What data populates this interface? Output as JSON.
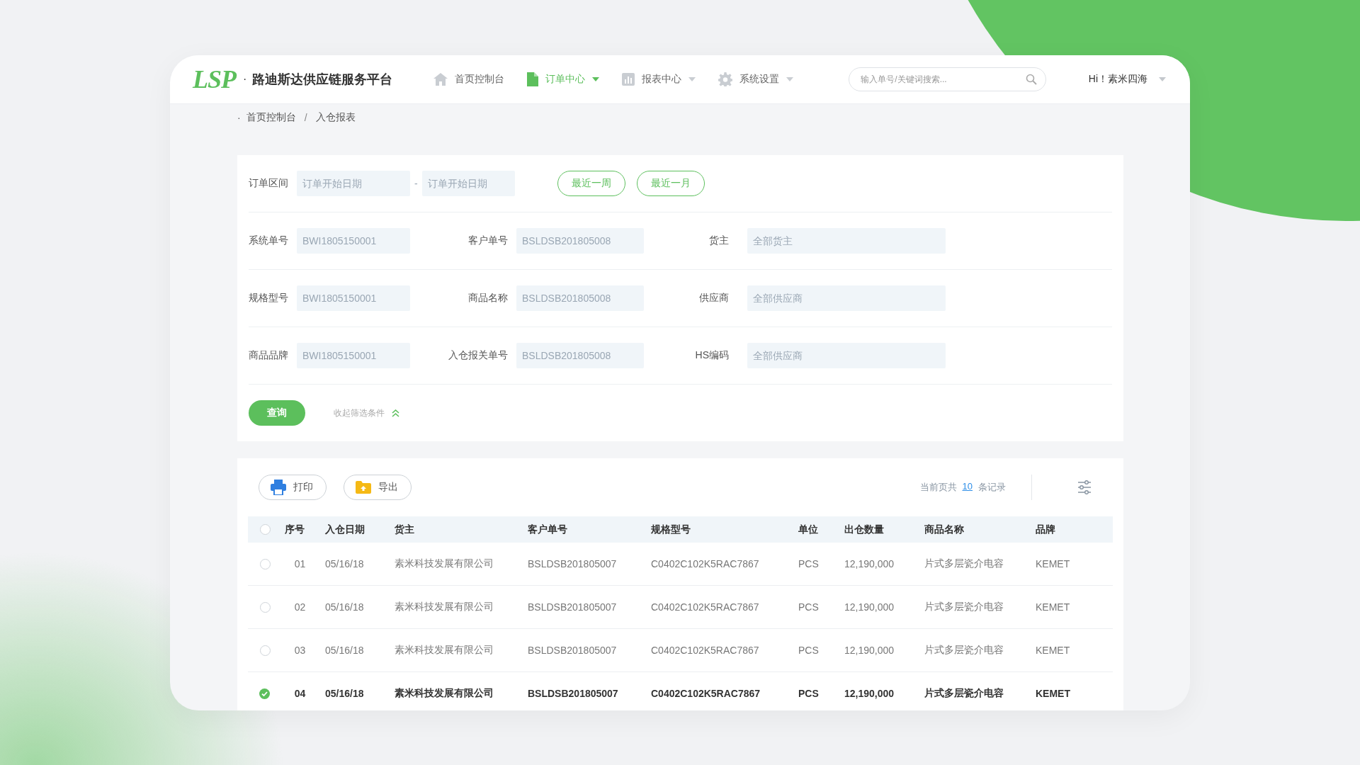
{
  "header": {
    "logo": "LSP",
    "separator": "·",
    "title": "路迪斯达供应链服务平台",
    "nav": [
      {
        "label": "首页控制台",
        "selected": false,
        "dropdown": false
      },
      {
        "label": "订单中心",
        "selected": true,
        "dropdown": true
      },
      {
        "label": "报表中心",
        "selected": false,
        "dropdown": true
      },
      {
        "label": "系统设置",
        "selected": false,
        "dropdown": true
      }
    ],
    "search": {
      "placeholder": "输入单号/关键词搜索..."
    },
    "user": "Hi！素米四海"
  },
  "breadcrumb": {
    "marker": "·",
    "items": [
      "首页控制台",
      "入仓报表"
    ],
    "separator": "/"
  },
  "filters": {
    "date_range": {
      "label": "订单区间",
      "start_placeholder": "订单开始日期",
      "separator": "-",
      "end_placeholder": "订单开始日期"
    },
    "quick_buttons": [
      "最近一周",
      "最近一月"
    ],
    "rows": [
      [
        {
          "label": "系统单号",
          "placeholder": "BWI1805150001"
        },
        {
          "label": "客户单号",
          "placeholder": "BSLDSB201805008"
        },
        {
          "label": "货主",
          "placeholder": "全部货主"
        }
      ],
      [
        {
          "label": "规格型号",
          "placeholder": "BWI1805150001"
        },
        {
          "label": "商品名称",
          "placeholder": "BSLDSB201805008"
        },
        {
          "label": "供应商",
          "placeholder": "全部供应商"
        }
      ],
      [
        {
          "label": "商品品牌",
          "placeholder": "BWI1805150001"
        },
        {
          "label": "入仓报关单号",
          "placeholder": "BSLDSB201805008"
        },
        {
          "label": "HS编码",
          "placeholder": "全部供应商"
        }
      ]
    ],
    "query_button": "查询",
    "collapse_link": "收起筛选条件"
  },
  "table": {
    "actions": [
      "打印",
      "导出"
    ],
    "record_count": {
      "prefix": "当前页共",
      "count": "10",
      "suffix": "条记录"
    },
    "all_selected": false,
    "columns": [
      "序号",
      "入仓日期",
      "货主",
      "客户单号",
      "规格型号",
      "单位",
      "出仓数量",
      "商品名称",
      "品牌"
    ],
    "rows": [
      {
        "selected": false,
        "cells": [
          "01",
          "05/16/18",
          "素米科技发展有限公司",
          "BSLDSB201805007",
          "C0402C102K5RAC7867",
          "PCS",
          "12,190,000",
          "片式多层瓷介电容",
          "KEMET"
        ]
      },
      {
        "selected": false,
        "cells": [
          "02",
          "05/16/18",
          "素米科技发展有限公司",
          "BSLDSB201805007",
          "C0402C102K5RAC7867",
          "PCS",
          "12,190,000",
          "片式多层瓷介电容",
          "KEMET"
        ]
      },
      {
        "selected": false,
        "cells": [
          "03",
          "05/16/18",
          "素米科技发展有限公司",
          "BSLDSB201805007",
          "C0402C102K5RAC7867",
          "PCS",
          "12,190,000",
          "片式多层瓷介电容",
          "KEMET"
        ]
      },
      {
        "selected": true,
        "cells": [
          "04",
          "05/16/18",
          "素米科技发展有限公司",
          "BSLDSB201805007",
          "C0402C102K5RAC7867",
          "PCS",
          "12,190,000",
          "片式多层瓷介电容",
          "KEMET"
        ]
      }
    ]
  }
}
